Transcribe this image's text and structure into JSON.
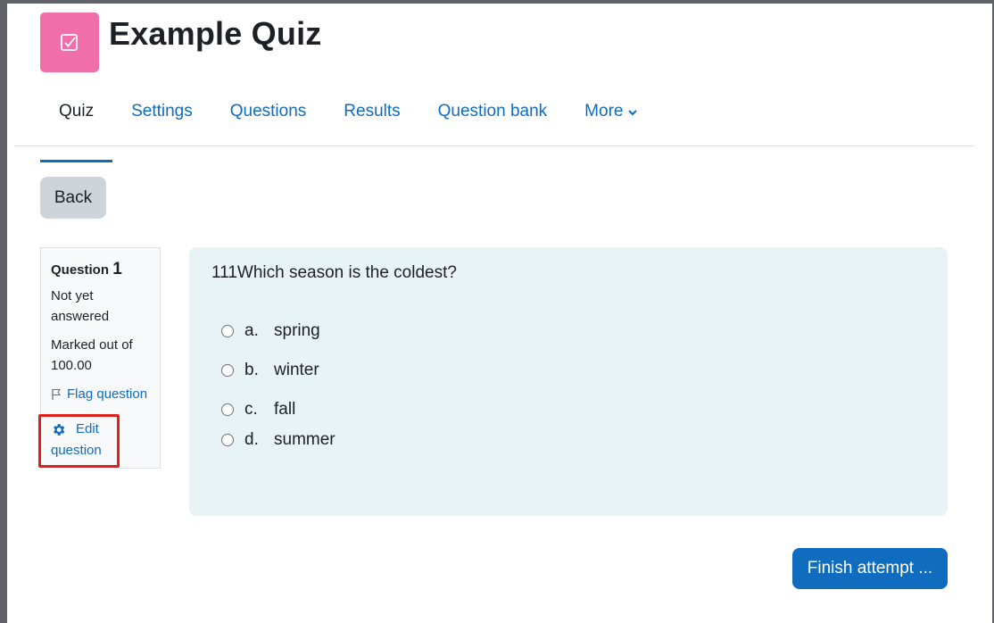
{
  "header": {
    "title": "Example Quiz",
    "icon": "quiz-checkbox-icon",
    "icon_color": "#f06eaa"
  },
  "tabs": [
    {
      "label": "Quiz",
      "active": true
    },
    {
      "label": "Settings",
      "active": false
    },
    {
      "label": "Questions",
      "active": false
    },
    {
      "label": "Results",
      "active": false
    },
    {
      "label": "Question bank",
      "active": false
    },
    {
      "label": "More",
      "active": false,
      "icon": "chevron-down-icon"
    }
  ],
  "back_button": "Back",
  "question_info": {
    "label": "Question",
    "number": "1",
    "state": "Not yet answered",
    "grade": "Marked out of 100.00",
    "flag_label": "Flag question",
    "edit_label_1": "Edit",
    "edit_label_2": "question"
  },
  "question": {
    "text": "111Which season is the coldest?",
    "answers": [
      {
        "letter": "a.",
        "text": "spring"
      },
      {
        "letter": "b.",
        "text": "winter"
      },
      {
        "letter": "c.",
        "text": "fall"
      },
      {
        "letter": "d.",
        "text": "summer"
      }
    ]
  },
  "finish_button": "Finish attempt ...",
  "colors": {
    "link": "#0f6cbf",
    "question_bg": "#e7f3f5",
    "highlight_border": "#e0201a"
  }
}
